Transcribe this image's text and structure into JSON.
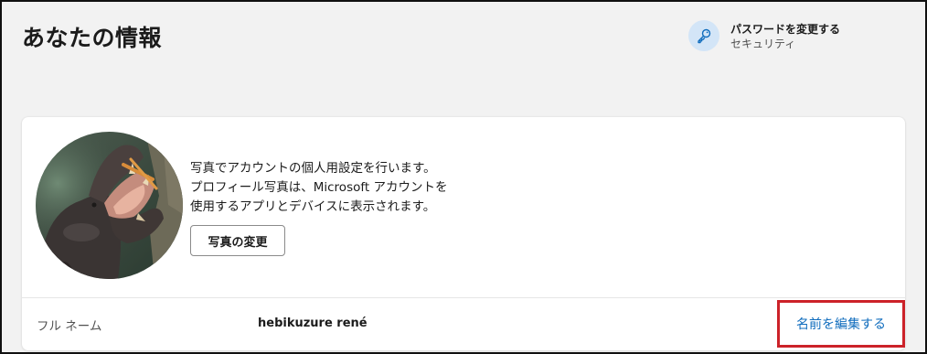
{
  "page": {
    "title": "あなたの情報"
  },
  "quick_action": {
    "title": "パスワードを変更する",
    "subtitle": "セキュリティ",
    "icon": "key-icon"
  },
  "profile_card": {
    "photo_description": [
      "写真でアカウントの個人用設定を行います。",
      "プロフィール写真は、Microsoft アカウントを",
      "使用するアプリとデバイスに表示されます。"
    ],
    "change_photo_label": "写真の変更",
    "full_name_label": "フル ネーム",
    "full_name_value": "hebikuzure rené",
    "edit_name_label": "名前を編集する"
  },
  "colors": {
    "accent_link": "#0f6cbd",
    "highlight_border": "#cc2229",
    "icon_circle": "#d3e5f7",
    "page_background": "#f2f2f2"
  }
}
